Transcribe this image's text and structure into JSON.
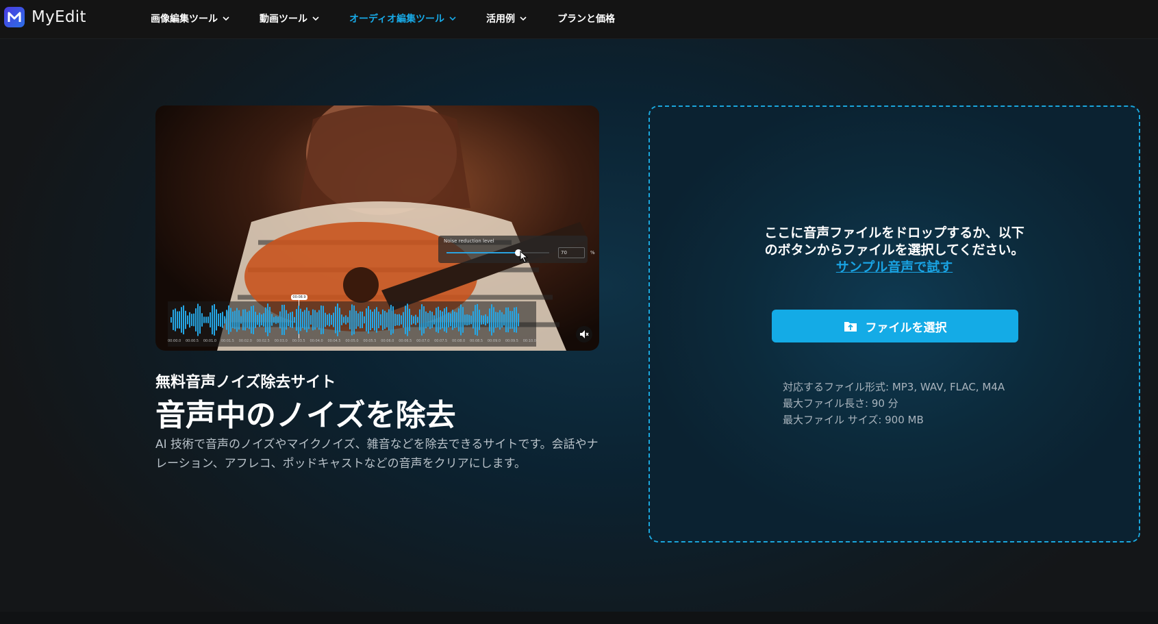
{
  "brand": {
    "name": "MyEdit",
    "accent": "#18a9e6"
  },
  "nav": [
    {
      "label": "画像編集ツール",
      "dropdown": true,
      "active": false
    },
    {
      "label": "動画ツール",
      "dropdown": true,
      "active": false
    },
    {
      "label": "オーディオ編集ツール",
      "dropdown": true,
      "active": true
    },
    {
      "label": "活用例",
      "dropdown": true,
      "active": false
    },
    {
      "label": "プランと価格",
      "dropdown": false,
      "active": false
    }
  ],
  "media": {
    "overlay_label": "Noise reduction level",
    "overlay_value": "70",
    "overlay_unit": "%",
    "slider_level_percent": 70,
    "playhead_time": "00:08.9",
    "time_ticks": [
      "00:00.0",
      "00:00.5",
      "00:01.0",
      "00:01.5",
      "00:02.0",
      "00:02.5",
      "00:03.0",
      "00:03.5",
      "00:04.0",
      "00:04.5",
      "00:05.0",
      "00:05.5",
      "00:06.0",
      "00:06.5",
      "00:07.0",
      "00:07.5",
      "00:08.0",
      "00:08.5",
      "00:09.0",
      "00:09.5",
      "00:10.0"
    ],
    "mute_icon": "speaker-muted-icon"
  },
  "hero": {
    "subtitle": "無料音声ノイズ除去サイト",
    "title": "音声中のノイズを除去",
    "description": "AI 技術で音声のノイズやマイクノイズ、雑音などを除去できるサイトです。会話やナレーション、アフレコ、ポッドキャストなどの音声をクリアにします。"
  },
  "upload": {
    "drop_text_line1": "ここに音声ファイルをドロップするか、以下",
    "drop_text_line2": "のボタンからファイルを選択してください。",
    "sample_link": "サンプル音声で試す",
    "button_label": "ファイルを選択",
    "specs": [
      "対応するファイル形式: MP3, WAV, FLAC, M4A",
      "最大ファイル長さ: 90 分",
      "最大ファイル サイズ: 900 MB"
    ]
  }
}
